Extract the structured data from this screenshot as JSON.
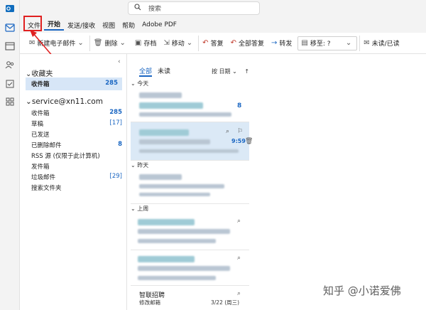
{
  "search": {
    "placeholder": "搜索"
  },
  "menu": {
    "items": [
      {
        "label": "文件"
      },
      {
        "label": "开始",
        "active": true
      },
      {
        "label": "发送/接收"
      },
      {
        "label": "视图"
      },
      {
        "label": "帮助"
      },
      {
        "label": "Adobe PDF"
      }
    ]
  },
  "toolbar": {
    "new_email": "新建电子邮件",
    "delete": "删除",
    "archive": "存档",
    "move": "移动",
    "reply": "答复",
    "reply_all": "全部答复",
    "forward": "转发",
    "move_to": "移至: ?",
    "unread_read": "未读/已读"
  },
  "folders": {
    "favorites_title": "收藏夹",
    "favorites": [
      {
        "name": "收件箱",
        "count": "285"
      }
    ],
    "account": "service@xn11.com",
    "items": [
      {
        "name": "收件箱",
        "count": "285"
      },
      {
        "name": "草稿",
        "count": "[17]"
      },
      {
        "name": "已发送",
        "count": ""
      },
      {
        "name": "已删除邮件",
        "count": "8"
      },
      {
        "name": "RSS 源 (仅限于此计算机)",
        "count": ""
      },
      {
        "name": "发件箱",
        "count": ""
      },
      {
        "name": "垃圾邮件",
        "count": "[29]"
      },
      {
        "name": "搜索文件夹",
        "count": ""
      }
    ]
  },
  "list": {
    "tab_all": "全部",
    "tab_unread": "未读",
    "sort": "按 日期",
    "groups": [
      "今天",
      "昨天",
      "上周"
    ],
    "item1_count": "8",
    "item2_time": "9:59",
    "last_sender": "智联招聘",
    "last_subject": "修改邮箱",
    "last_date": "3/22 (周三)"
  },
  "watermark": "知乎 @小诺爱佛",
  "colors": {
    "accent": "#1a66c2",
    "highlight": "#e02020",
    "selected": "#d7e6f7"
  }
}
